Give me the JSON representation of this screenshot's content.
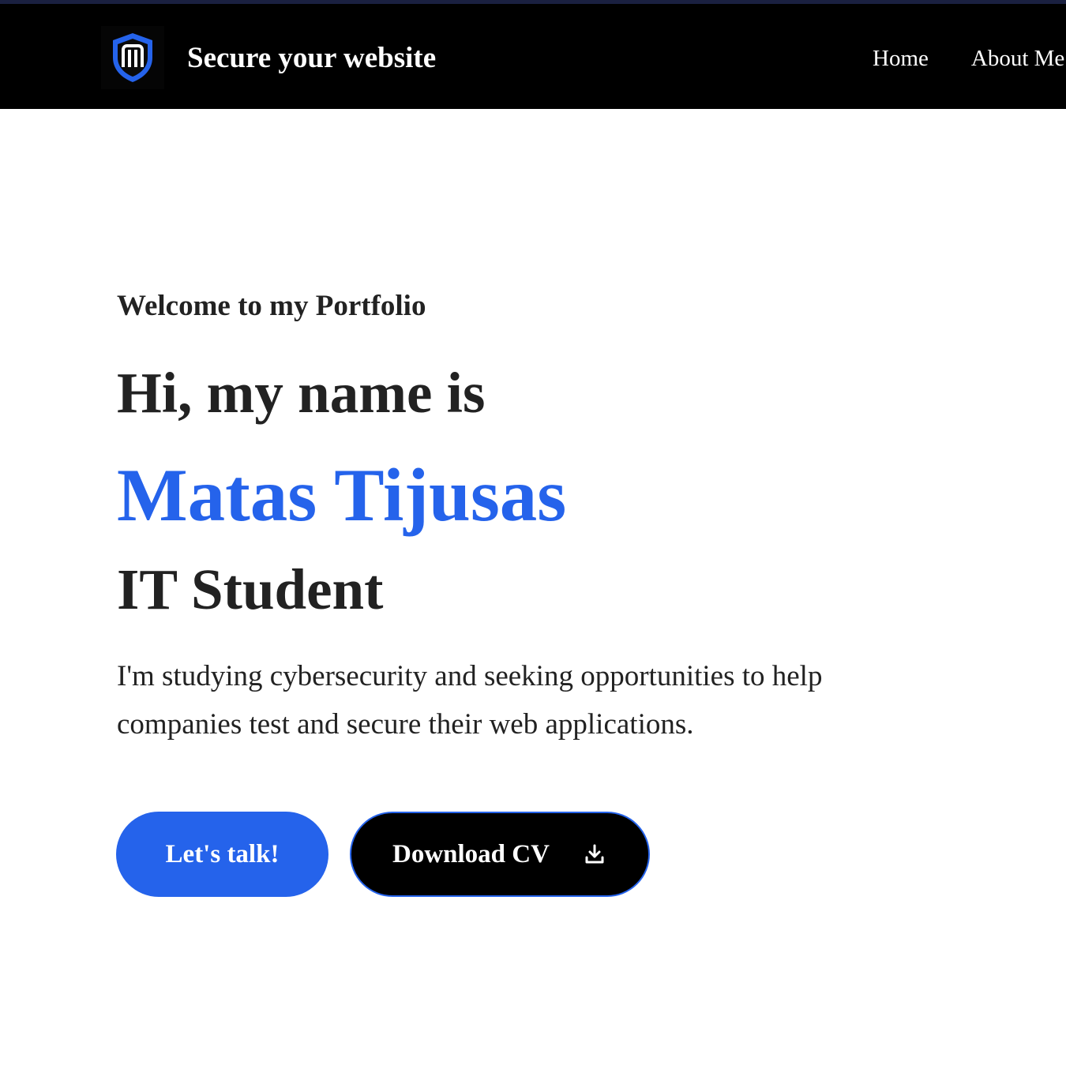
{
  "header": {
    "brand_title": "Secure your website",
    "logo_icon": "shield-m-icon",
    "nav": [
      {
        "label": "Home"
      },
      {
        "label": "About Me"
      }
    ]
  },
  "hero": {
    "welcome": "Welcome to my Portfolio",
    "greeting": "Hi, my name is",
    "name": "Matas Tijusas",
    "role": "IT Student",
    "description": "I'm studying cybersecurity and seeking opportunities to help companies test and secure their web applications."
  },
  "buttons": {
    "talk_label": "Let's talk!",
    "cv_label": "Download CV",
    "cv_icon": "download-icon"
  },
  "colors": {
    "accent": "#2563eb",
    "header_bg": "#000000",
    "text": "#222222"
  }
}
